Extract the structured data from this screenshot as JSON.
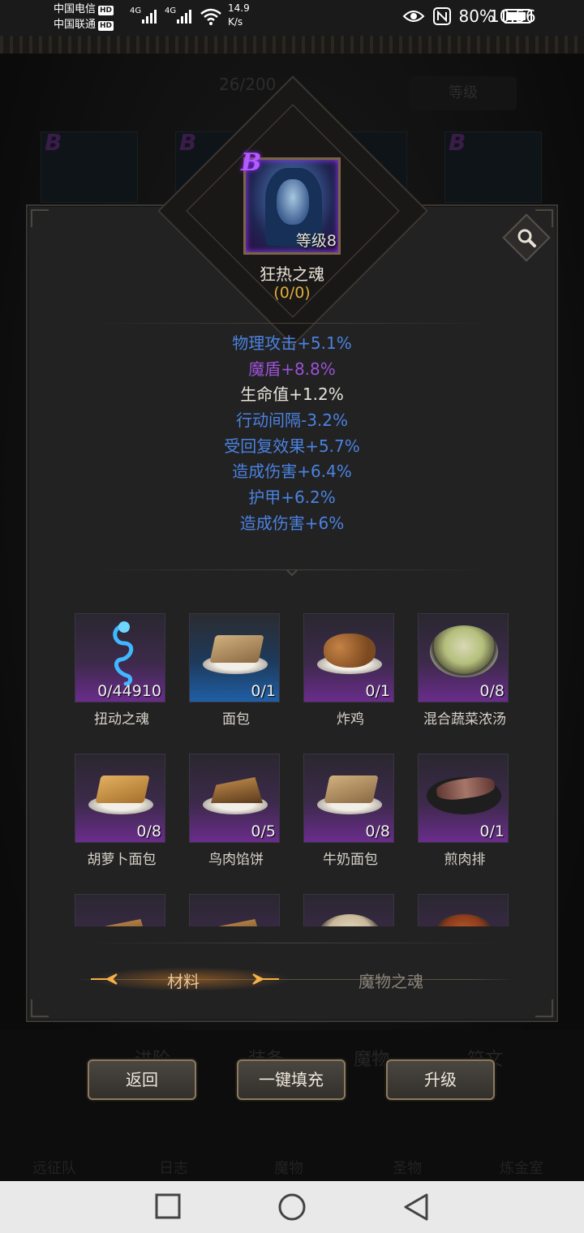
{
  "status_bar": {
    "carrier1": "中国电信",
    "carrier2": "中国联通",
    "hd": "HD",
    "net1": "4G",
    "net2": "4G",
    "speed_value": "14.9",
    "speed_unit": "K/s",
    "battery": "80%",
    "time": "10:56"
  },
  "background": {
    "count": "26/200",
    "level_button": "等级",
    "tabs": [
      "进阶",
      "装备",
      "魔物",
      "符文"
    ],
    "nav": [
      "远征队",
      "日志",
      "魔物",
      "圣物",
      "炼金室"
    ]
  },
  "soul": {
    "rank": "B",
    "level": "等级8",
    "name": "狂热之魂",
    "count": "(0/0)"
  },
  "stats": [
    {
      "text": "物理攻击+5.1%",
      "color": "blue"
    },
    {
      "text": "魔盾+8.8%",
      "color": "purple"
    },
    {
      "text": "生命值+1.2%",
      "color": "white"
    },
    {
      "text": "行动间隔-3.2%",
      "color": "blue"
    },
    {
      "text": "受回复效果+5.7%",
      "color": "blue"
    },
    {
      "text": "造成伤害+6.4%",
      "color": "blue"
    },
    {
      "text": "护甲+6.2%",
      "color": "blue"
    },
    {
      "text": "造成伤害+6%",
      "color": "blue"
    }
  ],
  "items": [
    {
      "name": "扭动之魂",
      "qty": "0/44910",
      "icon": "soul-wisp",
      "tier": "purple"
    },
    {
      "name": "面包",
      "qty": "0/1",
      "icon": "bread",
      "tier": "blue"
    },
    {
      "name": "炸鸡",
      "qty": "0/1",
      "icon": "fried-chicken",
      "tier": "purple"
    },
    {
      "name": "混合蔬菜浓汤",
      "qty": "0/8",
      "icon": "soup",
      "tier": "purple"
    },
    {
      "name": "胡萝卜面包",
      "qty": "0/8",
      "icon": "carrot-bread",
      "tier": "purple"
    },
    {
      "name": "鸟肉馅饼",
      "qty": "0/5",
      "icon": "meat-pie",
      "tier": "purple"
    },
    {
      "name": "牛奶面包",
      "qty": "0/8",
      "icon": "milk-bread",
      "tier": "purple"
    },
    {
      "name": "煎肉排",
      "qty": "0/1",
      "icon": "steak",
      "tier": "purple"
    }
  ],
  "tabs": {
    "materials": "材料",
    "monster_souls": "魔物之魂"
  },
  "buttons": {
    "back": "返回",
    "auto_fill": "一键填充",
    "upgrade": "升级"
  }
}
